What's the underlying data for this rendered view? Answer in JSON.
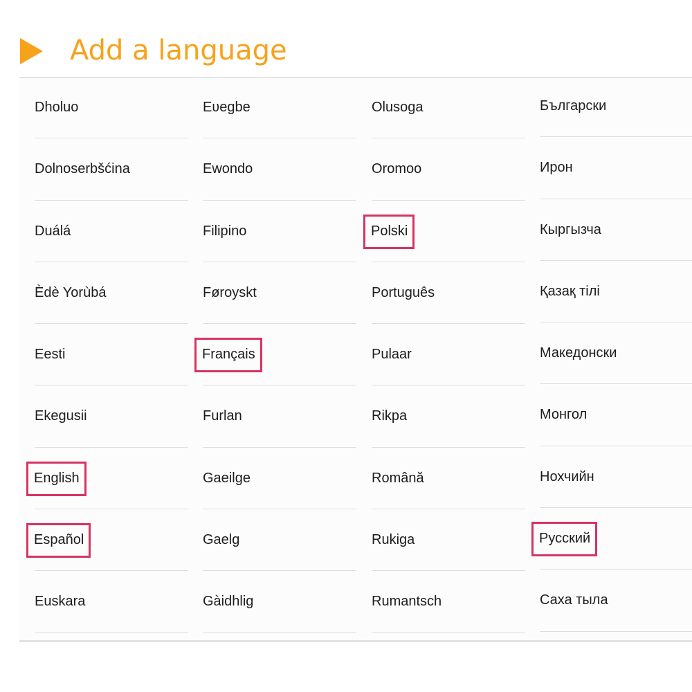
{
  "header": {
    "title": "Add a language",
    "icon": "play-icon",
    "accent_color": "#f7a21b"
  },
  "highlight_color": "#d63363",
  "columns": [
    {
      "items": [
        {
          "label": "Dholuo",
          "highlighted": false
        },
        {
          "label": "Dolnoserbšćina",
          "highlighted": false
        },
        {
          "label": "Duálá",
          "highlighted": false
        },
        {
          "label": "Èdè Yorùbá",
          "highlighted": false
        },
        {
          "label": "Eesti",
          "highlighted": false
        },
        {
          "label": "Ekegusii",
          "highlighted": false
        },
        {
          "label": "English",
          "highlighted": true
        },
        {
          "label": "Español",
          "highlighted": true
        },
        {
          "label": "Euskara",
          "highlighted": false
        }
      ]
    },
    {
      "items": [
        {
          "label": "Eʋegbe",
          "highlighted": false
        },
        {
          "label": "Ewondo",
          "highlighted": false
        },
        {
          "label": "Filipino",
          "highlighted": false
        },
        {
          "label": "Føroyskt",
          "highlighted": false
        },
        {
          "label": "Français",
          "highlighted": true
        },
        {
          "label": "Furlan",
          "highlighted": false
        },
        {
          "label": "Gaeilge",
          "highlighted": false
        },
        {
          "label": "Gaelg",
          "highlighted": false
        },
        {
          "label": "Gàidhlig",
          "highlighted": false
        }
      ]
    },
    {
      "items": [
        {
          "label": "Olusoga",
          "highlighted": false
        },
        {
          "label": "Oromoo",
          "highlighted": false
        },
        {
          "label": "Polski",
          "highlighted": true
        },
        {
          "label": "Português",
          "highlighted": false
        },
        {
          "label": "Pulaar",
          "highlighted": false
        },
        {
          "label": "Rikpa",
          "highlighted": false
        },
        {
          "label": "Română",
          "highlighted": false
        },
        {
          "label": "Rukiga",
          "highlighted": false
        },
        {
          "label": "Rumantsch",
          "highlighted": false
        }
      ]
    },
    {
      "items": [
        {
          "label": "Български",
          "highlighted": false
        },
        {
          "label": "Ирон",
          "highlighted": false
        },
        {
          "label": "Кыргызча",
          "highlighted": false
        },
        {
          "label": "Қазақ тілі",
          "highlighted": false
        },
        {
          "label": "Македонски",
          "highlighted": false
        },
        {
          "label": "Монгол",
          "highlighted": false
        },
        {
          "label": "Нохчийн",
          "highlighted": false
        },
        {
          "label": "Русский",
          "highlighted": true
        },
        {
          "label": "Саха тыла",
          "highlighted": false
        }
      ]
    }
  ]
}
